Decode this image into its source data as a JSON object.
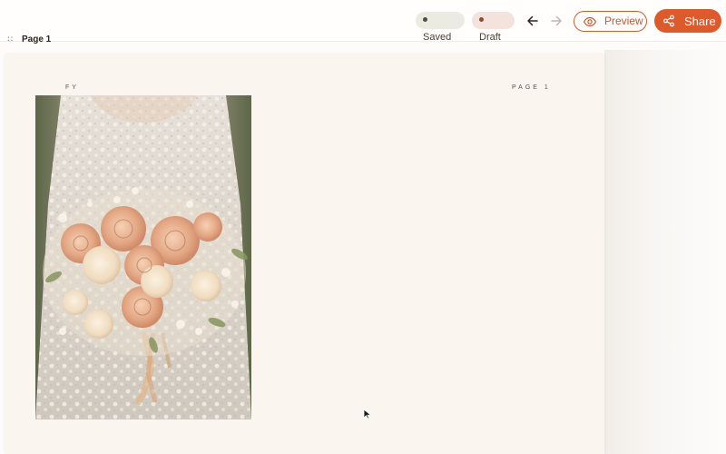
{
  "toolbar": {
    "saved_label": "Saved",
    "draft_label": "Draft",
    "preview_label": "Preview",
    "share_label": "Share",
    "colors": {
      "accent": "#dd5a2d",
      "saved_pill_bg": "#ecebe2",
      "draft_pill_bg": "#f3e3dc"
    },
    "icons": {
      "back": "arrow-left-icon",
      "forward": "arrow-right-icon",
      "preview": "eye-icon",
      "share": "share-icon"
    }
  },
  "page_list": {
    "handle": "::",
    "current_page_label": "Page 1"
  },
  "page": {
    "header_left": "FY",
    "header_right": "PAGE 1",
    "background": "#faf5ef",
    "photo_subject": "bridal-bouquet-photo"
  }
}
